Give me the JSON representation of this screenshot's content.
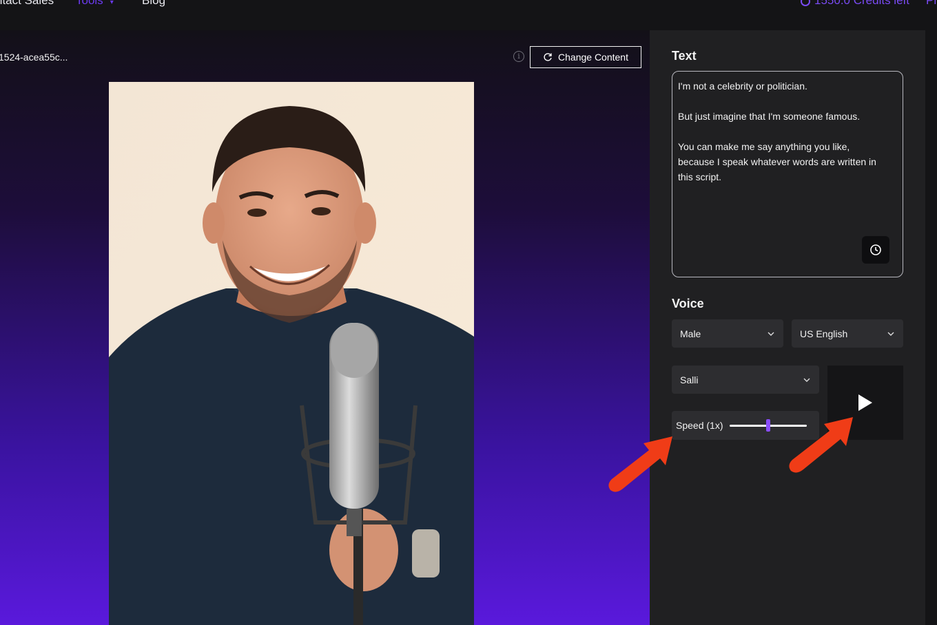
{
  "nav": {
    "contact_sales": "ntact Sales",
    "tools": "Tools",
    "blog": "Blog",
    "credits": "1550.0 Credits left",
    "credits_tail": "Pr"
  },
  "toolbar": {
    "file_name": "1524-acea55c...",
    "change_content_label": "Change Content"
  },
  "text_section": {
    "title": "Text",
    "script_lines": [
      "I'm not a celebrity or politician.",
      "But just imagine that I'm someone famous.",
      "You can make me say anything you like,",
      "because I speak whatever words are written in",
      "this script."
    ]
  },
  "voice_section": {
    "title": "Voice",
    "gender": "Male",
    "language": "US English",
    "voice": "Salli",
    "speed_label": "Speed (1x)",
    "speed_value": 0.5
  },
  "colors": {
    "accent": "#7a4bf4",
    "slider_thumb": "#8a4dff",
    "annotation_arrow": "#f03c17",
    "panel_bg": "#202022"
  },
  "icons": {
    "info": "info-icon",
    "refresh": "refresh-icon",
    "history": "clock-icon",
    "chevron": "chevron-down-icon",
    "play": "play-icon"
  }
}
